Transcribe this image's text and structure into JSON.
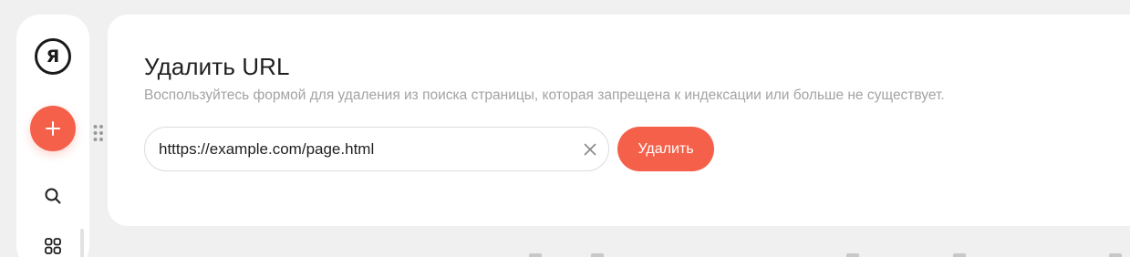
{
  "sidebar": {
    "logo_letter": "Я",
    "icons": {
      "add": "plus-icon",
      "search": "search-icon",
      "apps": "grid-icon",
      "drag": "drag-handle-icon"
    }
  },
  "form": {
    "title": "Удалить URL",
    "description": "Воспользуйтесь формой для удаления из поиска страницы, которая запрещена к индексации или больше не существует.",
    "url_value": "htttps://example.com/page.html",
    "submit_label": "Удалить",
    "clear_icon": "close-icon"
  },
  "colors": {
    "accent": "#f5604a",
    "background": "#f0f0f0",
    "card": "#ffffff",
    "muted_text": "#a3a3a3"
  }
}
